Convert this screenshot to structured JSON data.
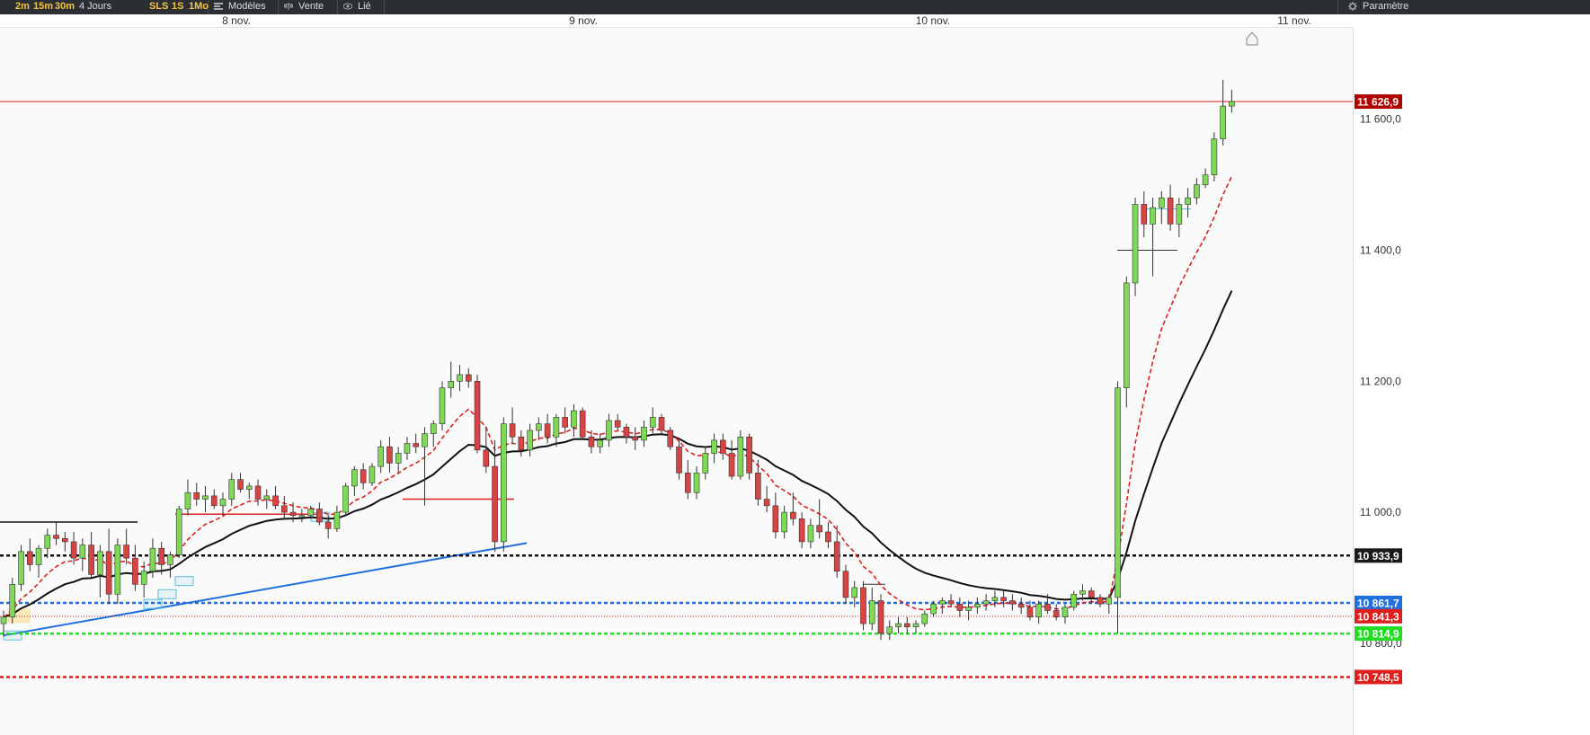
{
  "toolbar": {
    "timeframes_left": [
      "2m",
      "15m",
      "30m"
    ],
    "range_label": "4 Jours",
    "timeframes_right": [
      "SLS",
      "1S",
      "1Mo"
    ],
    "models_label": "Modèles",
    "sell_label": "Vente",
    "linked_label": "Lié",
    "settings_label": "Paramètre"
  },
  "colors": {
    "up": "#7ed957",
    "down": "#d84444",
    "ema_fast": "#e02020",
    "ema_slow": "#111111",
    "trend": "#1f6fe0",
    "toolbar_bg": "#2b2f33",
    "timeframe_text": "#f4c542"
  },
  "chart_data": {
    "type": "candlestick",
    "x_labels": [
      "8 nov.",
      "9 nov.",
      "10 nov.",
      "11 nov."
    ],
    "y_ticks": [
      "11 600,0",
      "11 400,0",
      "11 200,0",
      "11 000,0",
      "10 800,0"
    ],
    "y_range": [
      10660,
      11760
    ],
    "price_tags": [
      {
        "label": "11 626,9",
        "value": 11626.9,
        "style": "solid-red"
      },
      {
        "label": "10 933,9",
        "value": 10933.9,
        "style": "dashed-black"
      },
      {
        "label": "10 861,7",
        "value": 10861.7,
        "style": "dashed-blue"
      },
      {
        "label": "10 841,3",
        "value": 10841.3,
        "style": "dotted-red"
      },
      {
        "label": "10 814,9",
        "value": 10814.9,
        "style": "dashed-green"
      },
      {
        "label": "10 748,5",
        "value": 10748.5,
        "style": "dashed-red"
      }
    ],
    "candles": [
      [
        10830,
        10850,
        10810,
        10840
      ],
      [
        10840,
        10900,
        10830,
        10890
      ],
      [
        10890,
        10950,
        10880,
        10940
      ],
      [
        10940,
        10960,
        10910,
        10920
      ],
      [
        10920,
        10950,
        10900,
        10945
      ],
      [
        10945,
        10975,
        10930,
        10965
      ],
      [
        10965,
        10985,
        10950,
        10960
      ],
      [
        10960,
        10970,
        10940,
        10955
      ],
      [
        10955,
        10970,
        10920,
        10930
      ],
      [
        10930,
        10960,
        10910,
        10950
      ],
      [
        10950,
        10970,
        10900,
        10905
      ],
      [
        10905,
        10950,
        10870,
        10940
      ],
      [
        10940,
        10975,
        10860,
        10875
      ],
      [
        10875,
        10960,
        10860,
        10950
      ],
      [
        10950,
        10975,
        10920,
        10930
      ],
      [
        10930,
        10950,
        10880,
        10890
      ],
      [
        10890,
        10925,
        10870,
        10910
      ],
      [
        10910,
        10960,
        10900,
        10945
      ],
      [
        10945,
        10955,
        10905,
        10920
      ],
      [
        10920,
        10940,
        10900,
        10935
      ],
      [
        10935,
        11010,
        10930,
        11005
      ],
      [
        11005,
        11050,
        10995,
        11030
      ],
      [
        11030,
        11045,
        11010,
        11020
      ],
      [
        11020,
        11040,
        11000,
        11025
      ],
      [
        11025,
        11035,
        11005,
        11010
      ],
      [
        11010,
        11030,
        10995,
        11020
      ],
      [
        11020,
        11060,
        11010,
        11050
      ],
      [
        11050,
        11060,
        11030,
        11035
      ],
      [
        11035,
        11045,
        11020,
        11040
      ],
      [
        11040,
        11050,
        11010,
        11020
      ],
      [
        11020,
        11035,
        11005,
        11025
      ],
      [
        11025,
        11040,
        11005,
        11010
      ],
      [
        11010,
        11025,
        10990,
        11000
      ],
      [
        11000,
        11015,
        10985,
        10995
      ],
      [
        10995,
        11005,
        10985,
        10995
      ],
      [
        10995,
        11010,
        10990,
        11005
      ],
      [
        11005,
        11015,
        10980,
        10985
      ],
      [
        10985,
        10995,
        10960,
        10975
      ],
      [
        10975,
        11010,
        10970,
        11000
      ],
      [
        11000,
        11045,
        10995,
        11040
      ],
      [
        11040,
        11070,
        11025,
        11065
      ],
      [
        11065,
        11075,
        11035,
        11045
      ],
      [
        11045,
        11075,
        11040,
        11070
      ],
      [
        11070,
        11110,
        11060,
        11100
      ],
      [
        11100,
        11115,
        11060,
        11075
      ],
      [
        11075,
        11100,
        11060,
        11090
      ],
      [
        11090,
        11115,
        11080,
        11105
      ],
      [
        11105,
        11120,
        11090,
        11100
      ],
      [
        11100,
        11130,
        11010,
        11120
      ],
      [
        11120,
        11140,
        11100,
        11135
      ],
      [
        11135,
        11200,
        11125,
        11190
      ],
      [
        11190,
        11230,
        11175,
        11200
      ],
      [
        11200,
        11225,
        11185,
        11210
      ],
      [
        11210,
        11220,
        11190,
        11200
      ],
      [
        11200,
        11210,
        11090,
        11095
      ],
      [
        11095,
        11130,
        11060,
        11070
      ],
      [
        11070,
        11110,
        10940,
        10955
      ],
      [
        10955,
        11145,
        10940,
        11135
      ],
      [
        11135,
        11160,
        11105,
        11115
      ],
      [
        11115,
        11125,
        11085,
        11095
      ],
      [
        11095,
        11135,
        11085,
        11125
      ],
      [
        11125,
        11145,
        11110,
        11135
      ],
      [
        11135,
        11150,
        11105,
        11115
      ],
      [
        11115,
        11150,
        11100,
        11145
      ],
      [
        11145,
        11160,
        11120,
        11130
      ],
      [
        11130,
        11165,
        11115,
        11155
      ],
      [
        11155,
        11160,
        11110,
        11115
      ],
      [
        11115,
        11125,
        11090,
        11100
      ],
      [
        11100,
        11120,
        11090,
        11110
      ],
      [
        11110,
        11150,
        11100,
        11140
      ],
      [
        11140,
        11150,
        11125,
        11130
      ],
      [
        11130,
        11135,
        11105,
        11115
      ],
      [
        11115,
        11130,
        11095,
        11110
      ],
      [
        11110,
        11140,
        11100,
        11130
      ],
      [
        11130,
        11160,
        11120,
        11145
      ],
      [
        11145,
        11150,
        11120,
        11125
      ],
      [
        11125,
        11130,
        11095,
        11100
      ],
      [
        11100,
        11110,
        11050,
        11060
      ],
      [
        11060,
        11080,
        11020,
        11030
      ],
      [
        11030,
        11070,
        11020,
        11060
      ],
      [
        11060,
        11100,
        11050,
        11090
      ],
      [
        11090,
        11120,
        11075,
        11110
      ],
      [
        11110,
        11120,
        11080,
        11090
      ],
      [
        11090,
        11110,
        11050,
        11055
      ],
      [
        11055,
        11125,
        11050,
        11115
      ],
      [
        11115,
        11120,
        11050,
        11060
      ],
      [
        11060,
        11080,
        11010,
        11020
      ],
      [
        11020,
        11040,
        11000,
        11010
      ],
      [
        11010,
        11030,
        10960,
        10970
      ],
      [
        10970,
        11010,
        10960,
        11000
      ],
      [
        11000,
        11030,
        10980,
        10990
      ],
      [
        10990,
        11000,
        10945,
        10955
      ],
      [
        10955,
        10990,
        10945,
        10980
      ],
      [
        10980,
        11020,
        10960,
        10970
      ],
      [
        10970,
        10985,
        10945,
        10955
      ],
      [
        10955,
        10980,
        10900,
        10910
      ],
      [
        10910,
        10920,
        10860,
        10870
      ],
      [
        10870,
        10895,
        10855,
        10885
      ],
      [
        10885,
        10895,
        10820,
        10830
      ],
      [
        10830,
        10885,
        10820,
        10865
      ],
      [
        10865,
        10875,
        10805,
        10815
      ],
      [
        10815,
        10835,
        10805,
        10825
      ],
      [
        10825,
        10840,
        10815,
        10830
      ],
      [
        10830,
        10840,
        10815,
        10825
      ],
      [
        10825,
        10835,
        10815,
        10830
      ],
      [
        10830,
        10850,
        10825,
        10845
      ],
      [
        10845,
        10865,
        10840,
        10860
      ],
      [
        10860,
        10870,
        10845,
        10865
      ],
      [
        10865,
        10875,
        10855,
        10860
      ],
      [
        10860,
        10870,
        10840,
        10850
      ],
      [
        10850,
        10865,
        10835,
        10855
      ],
      [
        10855,
        10870,
        10845,
        10860
      ],
      [
        10860,
        10875,
        10850,
        10865
      ],
      [
        10865,
        10880,
        10855,
        10870
      ],
      [
        10870,
        10880,
        10855,
        10865
      ],
      [
        10865,
        10875,
        10850,
        10860
      ],
      [
        10860,
        10870,
        10845,
        10855
      ],
      [
        10855,
        10865,
        10835,
        10840
      ],
      [
        10840,
        10865,
        10830,
        10860
      ],
      [
        10860,
        10875,
        10845,
        10850
      ],
      [
        10850,
        10860,
        10835,
        10840
      ],
      [
        10840,
        10860,
        10830,
        10855
      ],
      [
        10855,
        10880,
        10850,
        10875
      ],
      [
        10875,
        10890,
        10865,
        10880
      ],
      [
        10880,
        10885,
        10860,
        10870
      ],
      [
        10870,
        10875,
        10855,
        10860
      ],
      [
        10860,
        10875,
        10845,
        10870
      ],
      [
        10870,
        11200,
        10815,
        11190
      ],
      [
        11190,
        11360,
        11160,
        11350
      ],
      [
        11350,
        11480,
        11330,
        11470
      ],
      [
        11470,
        11490,
        11420,
        11440
      ],
      [
        11440,
        11480,
        11360,
        11465
      ],
      [
        11465,
        11490,
        11440,
        11480
      ],
      [
        11480,
        11500,
        11430,
        11440
      ],
      [
        11440,
        11480,
        11420,
        11470
      ],
      [
        11470,
        11495,
        11450,
        11480
      ],
      [
        11480,
        11510,
        11470,
        11500
      ],
      [
        11500,
        11525,
        11495,
        11515
      ],
      [
        11515,
        11580,
        11505,
        11570
      ],
      [
        11570,
        11660,
        11560,
        11620
      ],
      [
        11620,
        11645,
        11610,
        11627
      ]
    ]
  }
}
